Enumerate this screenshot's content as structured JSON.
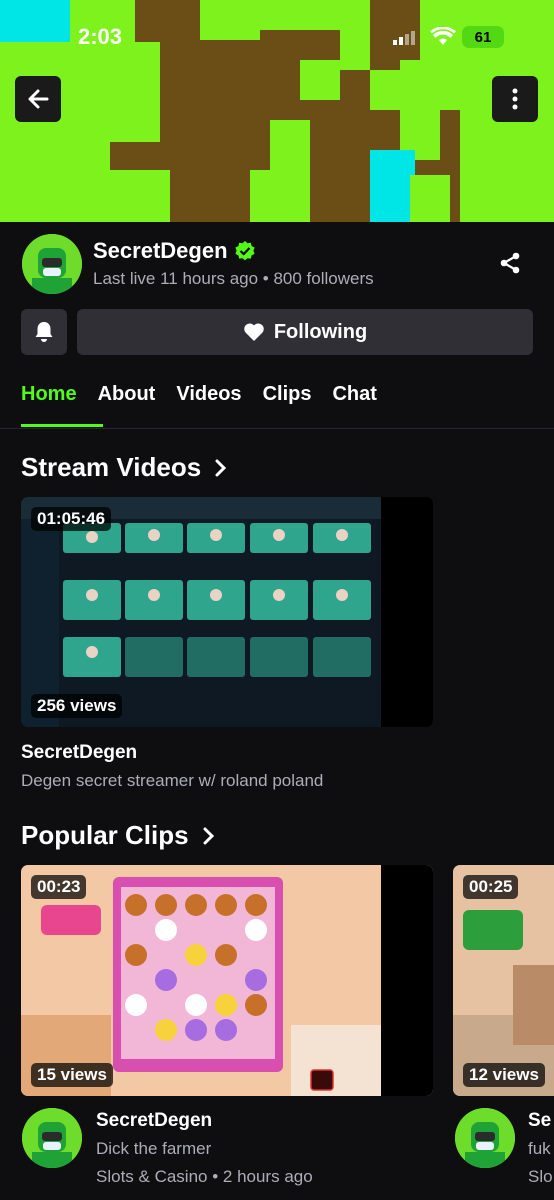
{
  "status_bar": {
    "time": "2:03",
    "battery": "61"
  },
  "channel": {
    "name": "SecretDegen",
    "meta": "Last live 11 hours ago • 800 followers",
    "follow_label": "Following"
  },
  "tabs": [
    "Home",
    "About",
    "Videos",
    "Clips",
    "Chat"
  ],
  "stream_videos": {
    "title": "Stream Videos",
    "items": [
      {
        "duration": "01:05:46",
        "views": "256 views",
        "channel": "SecretDegen",
        "title": "Degen secret streamer w/ roland poland"
      }
    ]
  },
  "popular_clips": {
    "title": "Popular Clips",
    "items": [
      {
        "duration": "00:23",
        "views": "15 views",
        "channel": "SecretDegen",
        "title": "Dick the farmer",
        "meta": "Slots & Casino • 2 hours ago"
      },
      {
        "duration": "00:25",
        "views": "12 views",
        "channel": "Se",
        "title": "fuk",
        "meta": "Slo"
      }
    ]
  },
  "colors": {
    "accent": "#53fc18",
    "background": "#0e0e10",
    "button": "#2f2f35",
    "verified": "#53fc18"
  }
}
